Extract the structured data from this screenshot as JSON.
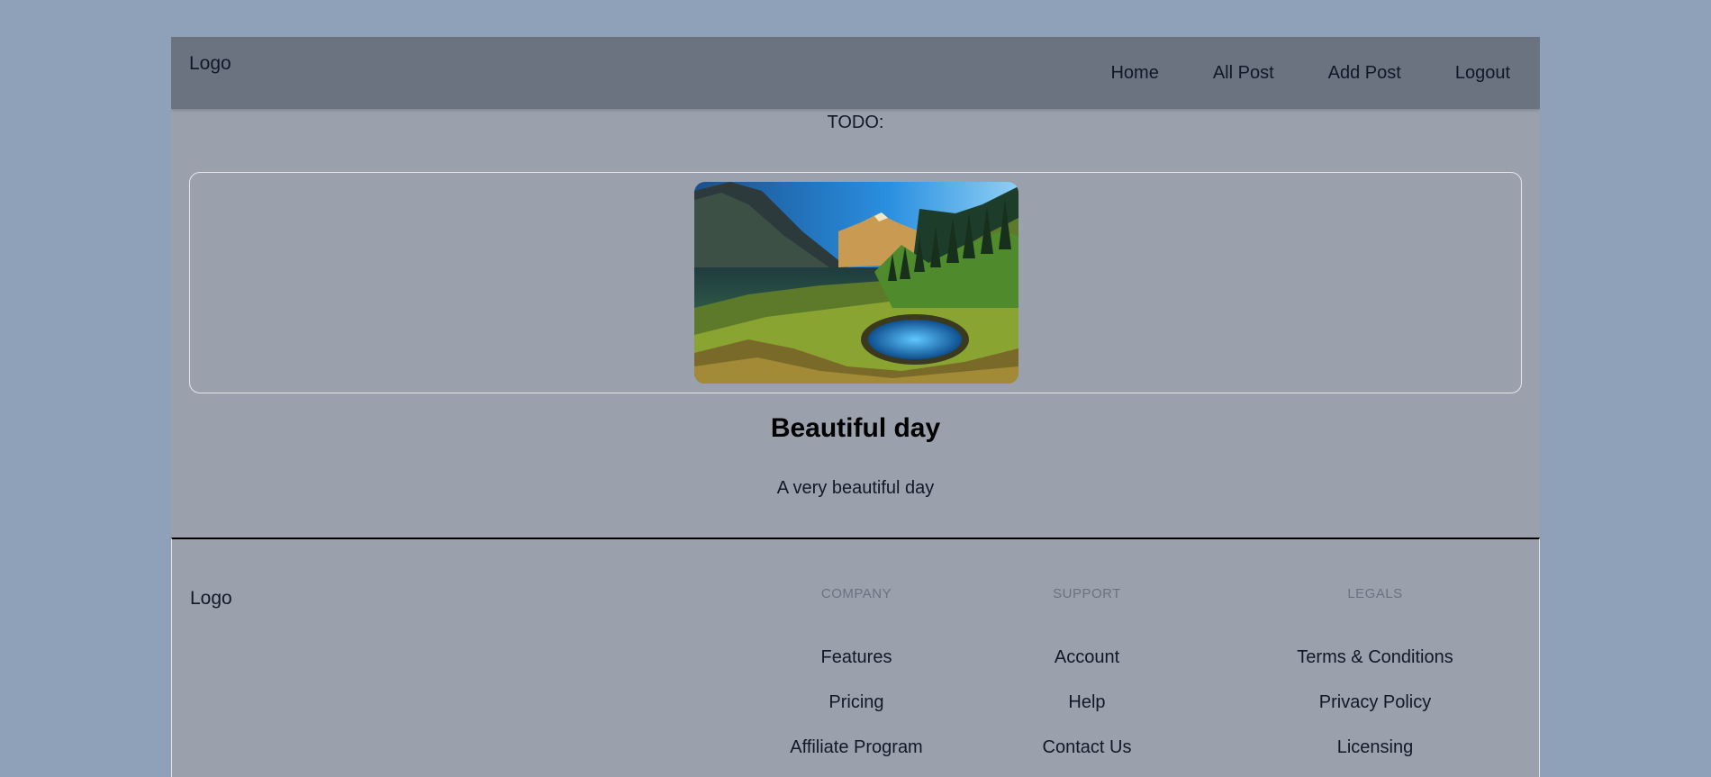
{
  "header": {
    "logo": "Logo",
    "nav": [
      "Home",
      "All Post",
      "Add Post",
      "Logout"
    ]
  },
  "main": {
    "todo": "TODO:",
    "post": {
      "title": "Beautiful day",
      "description": "A very beautiful day"
    }
  },
  "footer": {
    "logo": "Logo",
    "columns": [
      {
        "title": "COMPANY",
        "links": [
          "Features",
          "Pricing",
          "Affiliate Program"
        ]
      },
      {
        "title": "SUPPORT",
        "links": [
          "Account",
          "Help",
          "Contact Us"
        ]
      },
      {
        "title": "LEGALS",
        "links": [
          "Terms & Conditions",
          "Privacy Policy",
          "Licensing"
        ]
      }
    ]
  },
  "colors": {
    "background": "#8fa1b8",
    "page": "#9aa1ad",
    "header": "#6b7280"
  }
}
